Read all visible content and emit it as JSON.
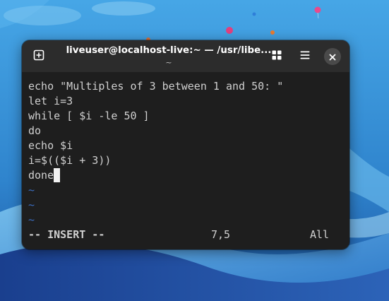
{
  "window": {
    "title": "liveuser@localhost-live:~ — /usr/libe...",
    "subtitle": "~"
  },
  "editor": {
    "lines": [
      "echo \"Multiples of 3 between 1 and 50: \"",
      "let i=3",
      "while [ $i -le 50 ]",
      "do",
      "echo $i",
      "i=$(($i + 3))",
      "done"
    ],
    "tildes": [
      "~",
      "~",
      "~"
    ],
    "status": {
      "mode": "-- INSERT --",
      "position": "7,5",
      "scroll": "All"
    }
  },
  "icons": {
    "new_tab": "new-tab-icon",
    "tab_overview": "grid-icon",
    "menu": "hamburger-menu-icon",
    "close": "close-icon"
  },
  "colors": {
    "terminal_bg": "#1e1e1e",
    "titlebar_bg": "#2c2c2c",
    "text": "#d0d0d0",
    "tilde": "#3b6dbf",
    "cursor": "#f2f2f2"
  }
}
